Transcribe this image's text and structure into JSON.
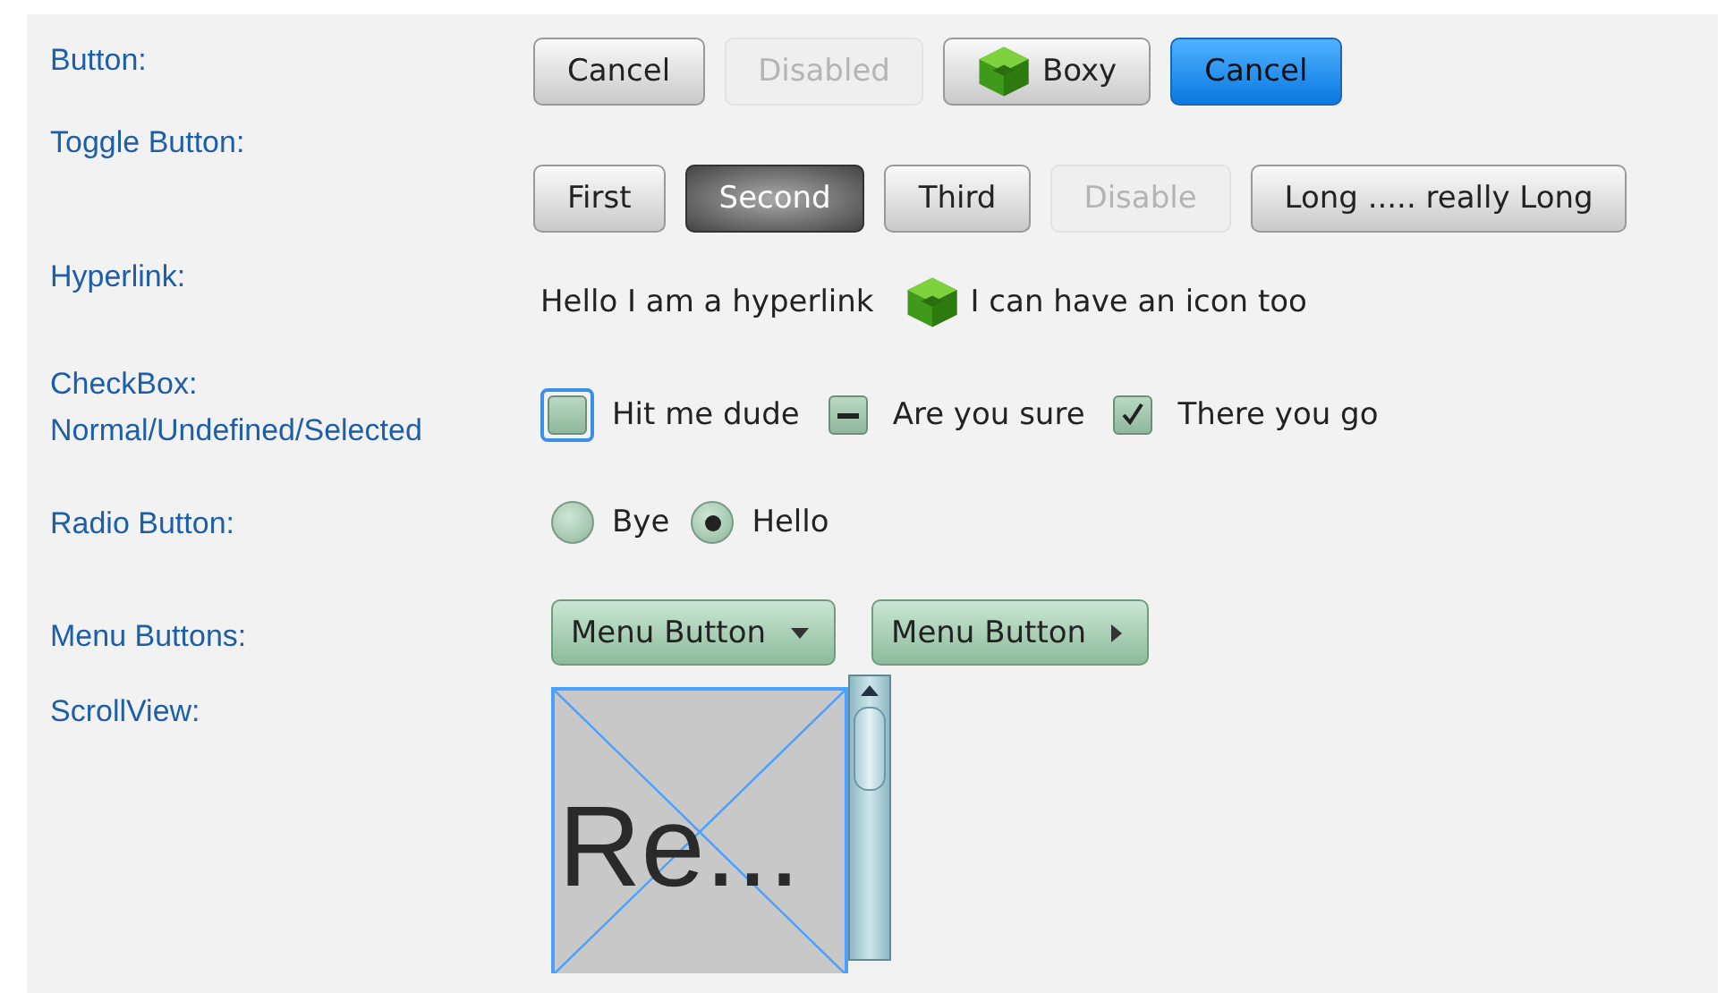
{
  "sections": [
    {
      "kind": "buttons",
      "label": [
        "Button:"
      ],
      "items": [
        {
          "text": "Cancel",
          "kind": "plain",
          "disabled": false
        },
        {
          "text": "Disabled",
          "kind": "plain",
          "disabled": true
        },
        {
          "text": "Boxy",
          "kind": "icon",
          "disabled": false
        },
        {
          "text": "Cancel",
          "kind": "default",
          "disabled": false
        }
      ]
    },
    {
      "kind": "toggles",
      "label": [
        "Toggle Button:"
      ],
      "items": [
        {
          "text": "First",
          "selected": false,
          "disabled": false
        },
        {
          "text": "Second",
          "selected": true,
          "disabled": false
        },
        {
          "text": "Third",
          "selected": false,
          "disabled": false
        },
        {
          "text": "Disable",
          "selected": false,
          "disabled": true
        },
        {
          "text": "Long ..... really Long",
          "selected": false,
          "disabled": false
        }
      ]
    },
    {
      "kind": "links",
      "label": [
        "Hyperlink:"
      ],
      "items": [
        {
          "text": "Hello I am a hyperlink",
          "kind": "text"
        },
        {
          "text": "I can have an icon too",
          "kind": "icon"
        }
      ]
    },
    {
      "kind": "checkboxes",
      "label": [
        "CheckBox:",
        "Normal/Undefined/Selected"
      ],
      "items": [
        {
          "text": "Hit me dude",
          "kind": "normal",
          "focused": true
        },
        {
          "text": "Are you sure",
          "kind": "undefined",
          "focused": false
        },
        {
          "text": "There you go",
          "kind": "selected",
          "focused": false
        }
      ]
    },
    {
      "kind": "radios",
      "label": [
        "Radio Button:"
      ],
      "items": [
        {
          "text": "Bye",
          "selected": false
        },
        {
          "text": "Hello",
          "selected": true
        }
      ]
    },
    {
      "kind": "menus",
      "label": [
        "Menu Buttons:"
      ],
      "items": [
        {
          "text": "Menu Button",
          "kind": "down"
        },
        {
          "text": "Menu Button",
          "kind": "right"
        }
      ]
    },
    {
      "kind": "scroll",
      "label": [
        "ScrollView:"
      ],
      "content": "Re..."
    }
  ]
}
